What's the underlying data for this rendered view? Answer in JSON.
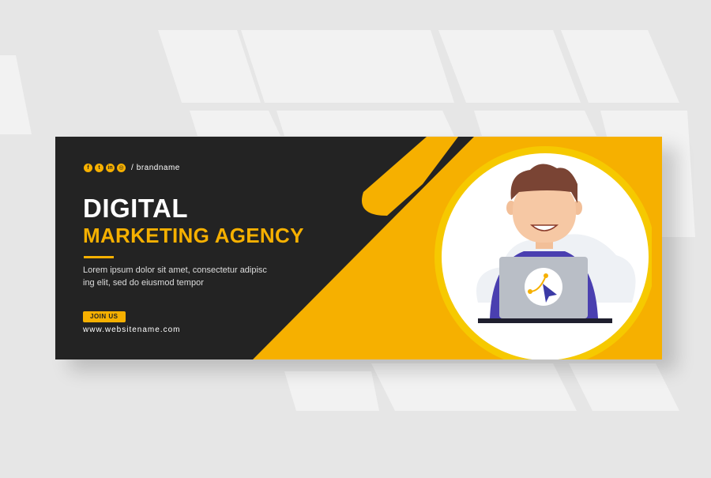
{
  "banner": {
    "social_icons": [
      "facebook-icon",
      "twitter-icon",
      "linkedin-icon",
      "instagram-icon"
    ],
    "brand_separator": "/",
    "brand_name": "brandname",
    "title_line1": "DIGITAL",
    "title_line2": "MARKETING AGENCY",
    "body_line1": "Lorem ipsum dolor sit amet, consectetur adipisc",
    "body_line2": "ing elit, sed do eiusmod tempor",
    "join_label": "JOIN US",
    "website": "www.websitename.com"
  },
  "colors": {
    "background": "#232323",
    "accent": "#f6b000",
    "page": "#e6e6e6"
  }
}
